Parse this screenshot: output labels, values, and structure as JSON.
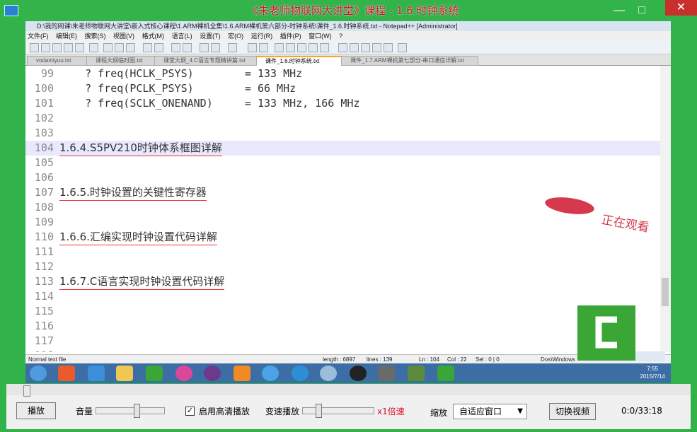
{
  "player": {
    "title": "《朱老师物联网大讲堂》课程 - 1.6.时钟系统",
    "close_glyph": "✕",
    "min_glyph": "—",
    "max_glyph": "□",
    "controls": {
      "play_label": "播放",
      "volume_label": "音量",
      "volume_level": 0.6,
      "hd_checked": true,
      "hd_label": "启用高清播放",
      "speed_label": "变速播放",
      "speed_value": "x1倍速",
      "zoom_label": "缩放",
      "zoom_value": "自适应窗口",
      "switch_label": "切换视频",
      "time": "0:0/33:18",
      "progress": 0.0
    }
  },
  "npp": {
    "window_title": "D:\\我的网课\\朱老师物联网大讲堂\\嵌入式核心课程\\1.ARM裸机全集\\1.6.ARM裸机第六部分-时钟系统\\课件_1.6.时钟系统.txt - Notepad++ [Administrator]",
    "menu": [
      "文件(F)",
      "编辑(E)",
      "搜索(S)",
      "视图(V)",
      "格式(M)",
      "语言(L)",
      "设置(T)",
      "宏(O)",
      "运行(R)",
      "插件(P)",
      "窗口(W)",
      "?"
    ],
    "tabs": [
      {
        "label": "vodamiyuu.txt"
      },
      {
        "label": "课程大纲临时图.txt"
      },
      {
        "label": "课堂大纲_4.C语言专题精讲篇.txt"
      },
      {
        "label": "课件_1.6.时钟系统.txt",
        "active": true
      },
      {
        "label": "课件_1.7.ARM裸机第七部分-串口通信详解.txt"
      }
    ],
    "lines": [
      {
        "n": "99",
        "text": "    ? freq(HCLK_PSYS)        = 133 MHz"
      },
      {
        "n": "100",
        "text": "    ? freq(PCLK_PSYS)        = 66 MHz"
      },
      {
        "n": "101",
        "text": "    ? freq(SCLK_ONENAND)     = 133 MHz, 166 MHz"
      },
      {
        "n": "102",
        "text": ""
      },
      {
        "n": "103",
        "text": ""
      },
      {
        "n": "104",
        "text": "1.6.4.S5PV210时钟体系框图详解",
        "highlight": true,
        "cn": true
      },
      {
        "n": "105",
        "text": ""
      },
      {
        "n": "106",
        "text": ""
      },
      {
        "n": "107",
        "text": "1.6.5.时钟设置的关键性寄存器",
        "cn": true
      },
      {
        "n": "108",
        "text": ""
      },
      {
        "n": "109",
        "text": ""
      },
      {
        "n": "110",
        "text": "1.6.6.汇编实现时钟设置代码详解",
        "cn": true
      },
      {
        "n": "111",
        "text": ""
      },
      {
        "n": "112",
        "text": ""
      },
      {
        "n": "113",
        "text": "1.6.7.C语言实现时钟设置代码详解",
        "cn": true
      },
      {
        "n": "114",
        "text": ""
      },
      {
        "n": "115",
        "text": ""
      },
      {
        "n": "116",
        "text": ""
      },
      {
        "n": "117",
        "text": ""
      },
      {
        "n": "118",
        "text": ""
      }
    ],
    "status": {
      "type": "Normal text file",
      "length": "length : 6897",
      "lines": "lines : 139",
      "ln": "Ln : 104",
      "col": "Col : 22",
      "sel": "Sel : 0 | 0",
      "eol": "Dos\\Windows"
    }
  },
  "taskbar": {
    "time": "7:55",
    "date": "2015/7/14"
  },
  "watermark": {
    "text": "正在观看"
  },
  "colors": {
    "player_green": "#32b44b",
    "title_red": "#d4102a",
    "camtasia_green": "#3aa635"
  }
}
